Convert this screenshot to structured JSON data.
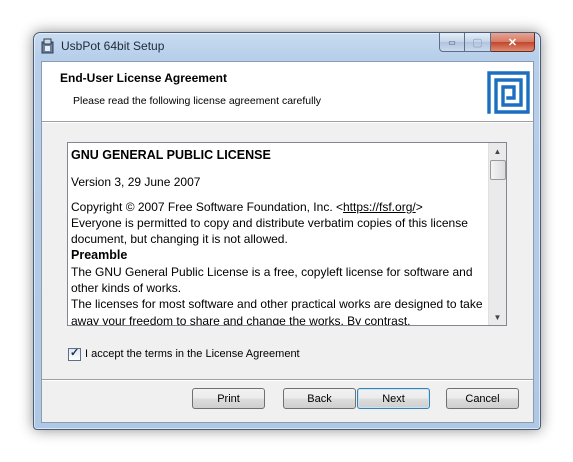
{
  "window": {
    "title": "UsbPot 64bit Setup",
    "controls": {
      "minimize": "▭",
      "maximize": "▢",
      "close": "✕"
    }
  },
  "banner": {
    "title": "End-User License Agreement",
    "subtitle": "Please read the following license agreement carefully",
    "logo_icon": "square-spiral-logo-icon"
  },
  "license": {
    "heading": "GNU GENERAL PUBLIC LICENSE",
    "version": "Version 3, 29 June 2007",
    "copyright_prefix": "Copyright © 2007 Free Software Foundation, Inc. <",
    "copyright_link": "https://fsf.org/",
    "copyright_suffix": ">",
    "copyright_rest": "Everyone is permitted to copy and distribute verbatim copies of this license document, but changing it is not allowed.",
    "preamble_heading": "Preamble",
    "preamble_p1": "The GNU General Public License is a free, copyleft license for software and other kinds of works.",
    "preamble_p2": "The licenses for most software and other practical works are designed to take away your freedom to share and change the works. By contrast,"
  },
  "scrollbar": {
    "up_arrow": "▲",
    "down_arrow": "▼",
    "position": 0
  },
  "accept": {
    "label": "I accept the terms in the License Agreement",
    "checked": true,
    "check_glyph": "✓"
  },
  "buttons": {
    "print": "Print",
    "back": "Back",
    "next": "Next",
    "cancel": "Cancel"
  },
  "colors": {
    "logo_blue": "#1c6fc0",
    "frame": "#b7cfea",
    "default_button_border": "#3c7fb1"
  }
}
